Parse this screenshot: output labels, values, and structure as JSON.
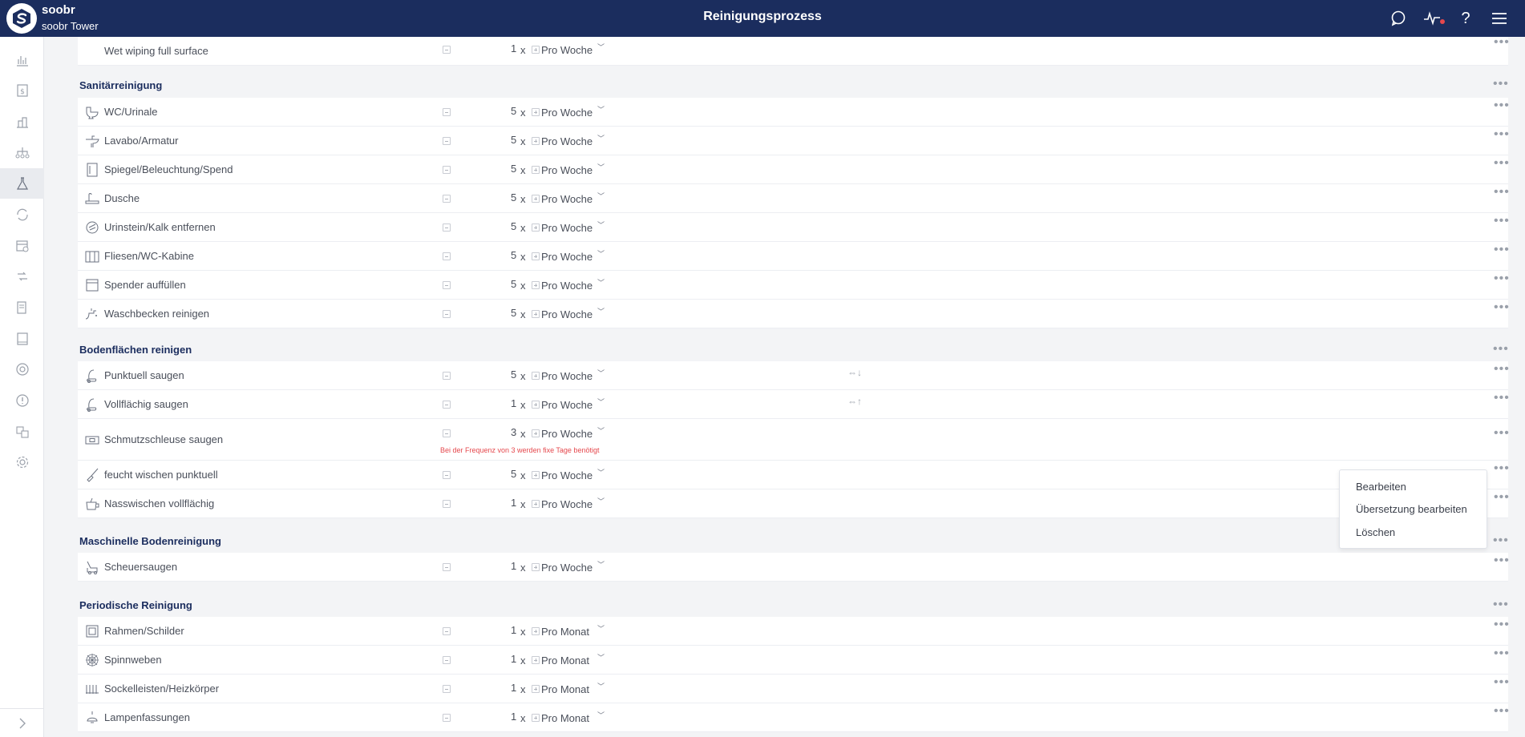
{
  "header": {
    "brand_name": "soobr",
    "brand_sub": "soobr Tower",
    "title": "Reinigungsprozess",
    "icons": [
      "chat-icon",
      "activity-icon",
      "help-icon",
      "menu-icon"
    ]
  },
  "sidebar": {
    "items": [
      "chart-icon",
      "dollar-icon",
      "building-icon",
      "org-chart-icon",
      "flask-icon",
      "sync-icon",
      "calendar-icon",
      "transfer-icon",
      "document-icon",
      "book-icon",
      "target-icon",
      "alert-icon",
      "translate-icon",
      "settings-icon"
    ],
    "active": "flask-icon"
  },
  "sections": [
    {
      "title": "",
      "rows": [
        {
          "name": "Wet wiping full surface",
          "count": "1",
          "period": "Pro Woche",
          "icon": "none"
        }
      ]
    },
    {
      "title": "Sanitärreinigung",
      "rows": [
        {
          "name": "WC/Urinale",
          "count": "5",
          "period": "Pro Woche",
          "icon": "toilet-icon"
        },
        {
          "name": "Lavabo/Armatur",
          "count": "5",
          "period": "Pro Woche",
          "icon": "sink-icon"
        },
        {
          "name": "Spiegel/Beleuchtung/Spend",
          "count": "5",
          "period": "Pro Woche",
          "icon": "mirror-icon"
        },
        {
          "name": "Dusche",
          "count": "5",
          "period": "Pro Woche",
          "icon": "shower-icon"
        },
        {
          "name": "Urinstein/Kalk entfernen",
          "count": "5",
          "period": "Pro Woche",
          "icon": "scale-removal-icon"
        },
        {
          "name": "Fliesen/WC-Kabine",
          "count": "5",
          "period": "Pro Woche",
          "icon": "tiles-icon"
        },
        {
          "name": "Spender auffüllen",
          "count": "5",
          "period": "Pro Woche",
          "icon": "dispenser-icon"
        },
        {
          "name": "Waschbecken reinigen",
          "count": "5",
          "period": "Pro Woche",
          "icon": "faucet-icon"
        }
      ]
    },
    {
      "title": "Bodenflächen reinigen",
      "rows": [
        {
          "name": "Punktuell saugen",
          "count": "5",
          "period": "Pro Woche",
          "icon": "vacuum-icon",
          "link": "⇔↓"
        },
        {
          "name": "Vollflächig saugen",
          "count": "1",
          "period": "Pro Woche",
          "icon": "vacuum-icon",
          "link": "⇔↑"
        },
        {
          "name": "Schmutzschleuse saugen",
          "count": "3",
          "period": "Pro Woche",
          "icon": "mat-icon",
          "warning": "Bei der Frequenz von 3 werden fixe Tage benötigt"
        },
        {
          "name": "feucht wischen punktuell",
          "count": "5",
          "period": "Pro Woche",
          "icon": "mop-icon"
        },
        {
          "name": "Nasswischen vollflächig",
          "count": "1",
          "period": "Pro Woche",
          "icon": "bucket-icon"
        }
      ]
    },
    {
      "title": "Maschinelle Bodenreinigung",
      "rows": [
        {
          "name": "Scheuersaugen",
          "count": "1",
          "period": "Pro Woche",
          "icon": "scrubber-icon"
        }
      ]
    },
    {
      "title": "Periodische Reinigung",
      "rows": [
        {
          "name": "Rahmen/Schilder",
          "count": "1",
          "period": "Pro Monat",
          "icon": "frame-icon"
        },
        {
          "name": "Spinnweben",
          "count": "1",
          "period": "Pro Monat",
          "icon": "spiderweb-icon"
        },
        {
          "name": "Sockelleisten/Heizkörper",
          "count": "1",
          "period": "Pro Monat",
          "icon": "radiator-icon"
        },
        {
          "name": "Lampenfassungen",
          "count": "1",
          "period": "Pro Monat",
          "icon": "lamp-icon"
        }
      ]
    }
  ],
  "freq_separator": "x",
  "context_menu": {
    "items": [
      "Bearbeiten",
      "Übersetzung bearbeiten",
      "Löschen"
    ]
  },
  "colors": {
    "header_bg": "#1b2d5e",
    "warning": "#e5484d",
    "section_title": "#1b2d5e"
  }
}
